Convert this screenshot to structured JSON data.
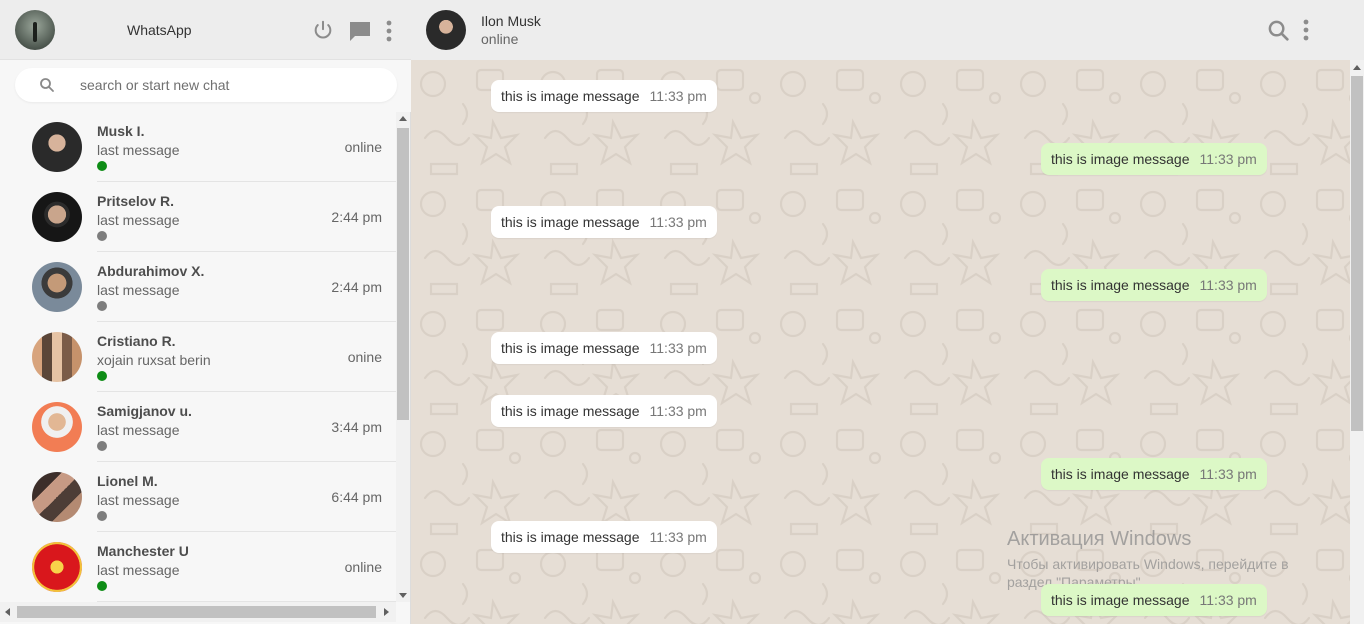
{
  "sidebar": {
    "app_title": "WhatsApp",
    "search": {
      "placeholder": "search or start new chat",
      "value": ""
    },
    "chats": [
      {
        "name": "Musk I.",
        "last_message": "last message",
        "time": "online",
        "status_color": "#0d8c15"
      },
      {
        "name": "Pritselov R.",
        "last_message": "last message",
        "time": "2:44 pm",
        "status_color": "#7d7d7d"
      },
      {
        "name": "Abdurahimov X.",
        "last_message": "last message",
        "time": "2:44 pm",
        "status_color": "#7d7d7d"
      },
      {
        "name": "Cristiano R.",
        "last_message": "xojain ruxsat berin",
        "time": "onine",
        "status_color": "#0d8c15"
      },
      {
        "name": "Samigjanov u.",
        "last_message": "last message",
        "time": "3:44 pm",
        "status_color": "#7d7d7d"
      },
      {
        "name": "Lionel M.",
        "last_message": "last message",
        "time": "6:44 pm",
        "status_color": "#7d7d7d"
      },
      {
        "name": "Manchester U",
        "last_message": "last message",
        "time": "online",
        "status_color": "#0d8c15"
      }
    ]
  },
  "conversation": {
    "contact_name": "Ilon Musk",
    "contact_status": "online",
    "messages": [
      {
        "direction": "in",
        "text": "this is image message",
        "time": "11:33 pm"
      },
      {
        "direction": "out",
        "text": "this is image message",
        "time": "11:33 pm"
      },
      {
        "direction": "in",
        "text": "this is image message",
        "time": "11:33 pm"
      },
      {
        "direction": "out",
        "text": "this is image message",
        "time": "11:33 pm"
      },
      {
        "direction": "in",
        "text": "this is image message",
        "time": "11:33 pm"
      },
      {
        "direction": "in",
        "text": "this is image message",
        "time": "11:33 pm"
      },
      {
        "direction": "out",
        "text": "this is image message",
        "time": "11:33 pm"
      },
      {
        "direction": "in",
        "text": "this is image message",
        "time": "11:33 pm"
      },
      {
        "direction": "out",
        "text": "this is image message",
        "time": "11:33 pm"
      }
    ]
  },
  "watermark": {
    "title": "Активация Windows",
    "line1": "Чтобы активировать Windows, перейдите в",
    "line2": "раздел \"Параметры\"."
  },
  "icons": {
    "header": [
      "power-icon",
      "new-chat-icon",
      "menu-icon"
    ],
    "conversation_header": [
      "search-icon",
      "menu-icon"
    ]
  },
  "colors": {
    "online": "#0d8c15",
    "offline": "#7d7d7d",
    "incoming_bubble": "#ffffff",
    "outgoing_bubble": "#dcf8c6",
    "chat_background": "#e6ded5"
  }
}
